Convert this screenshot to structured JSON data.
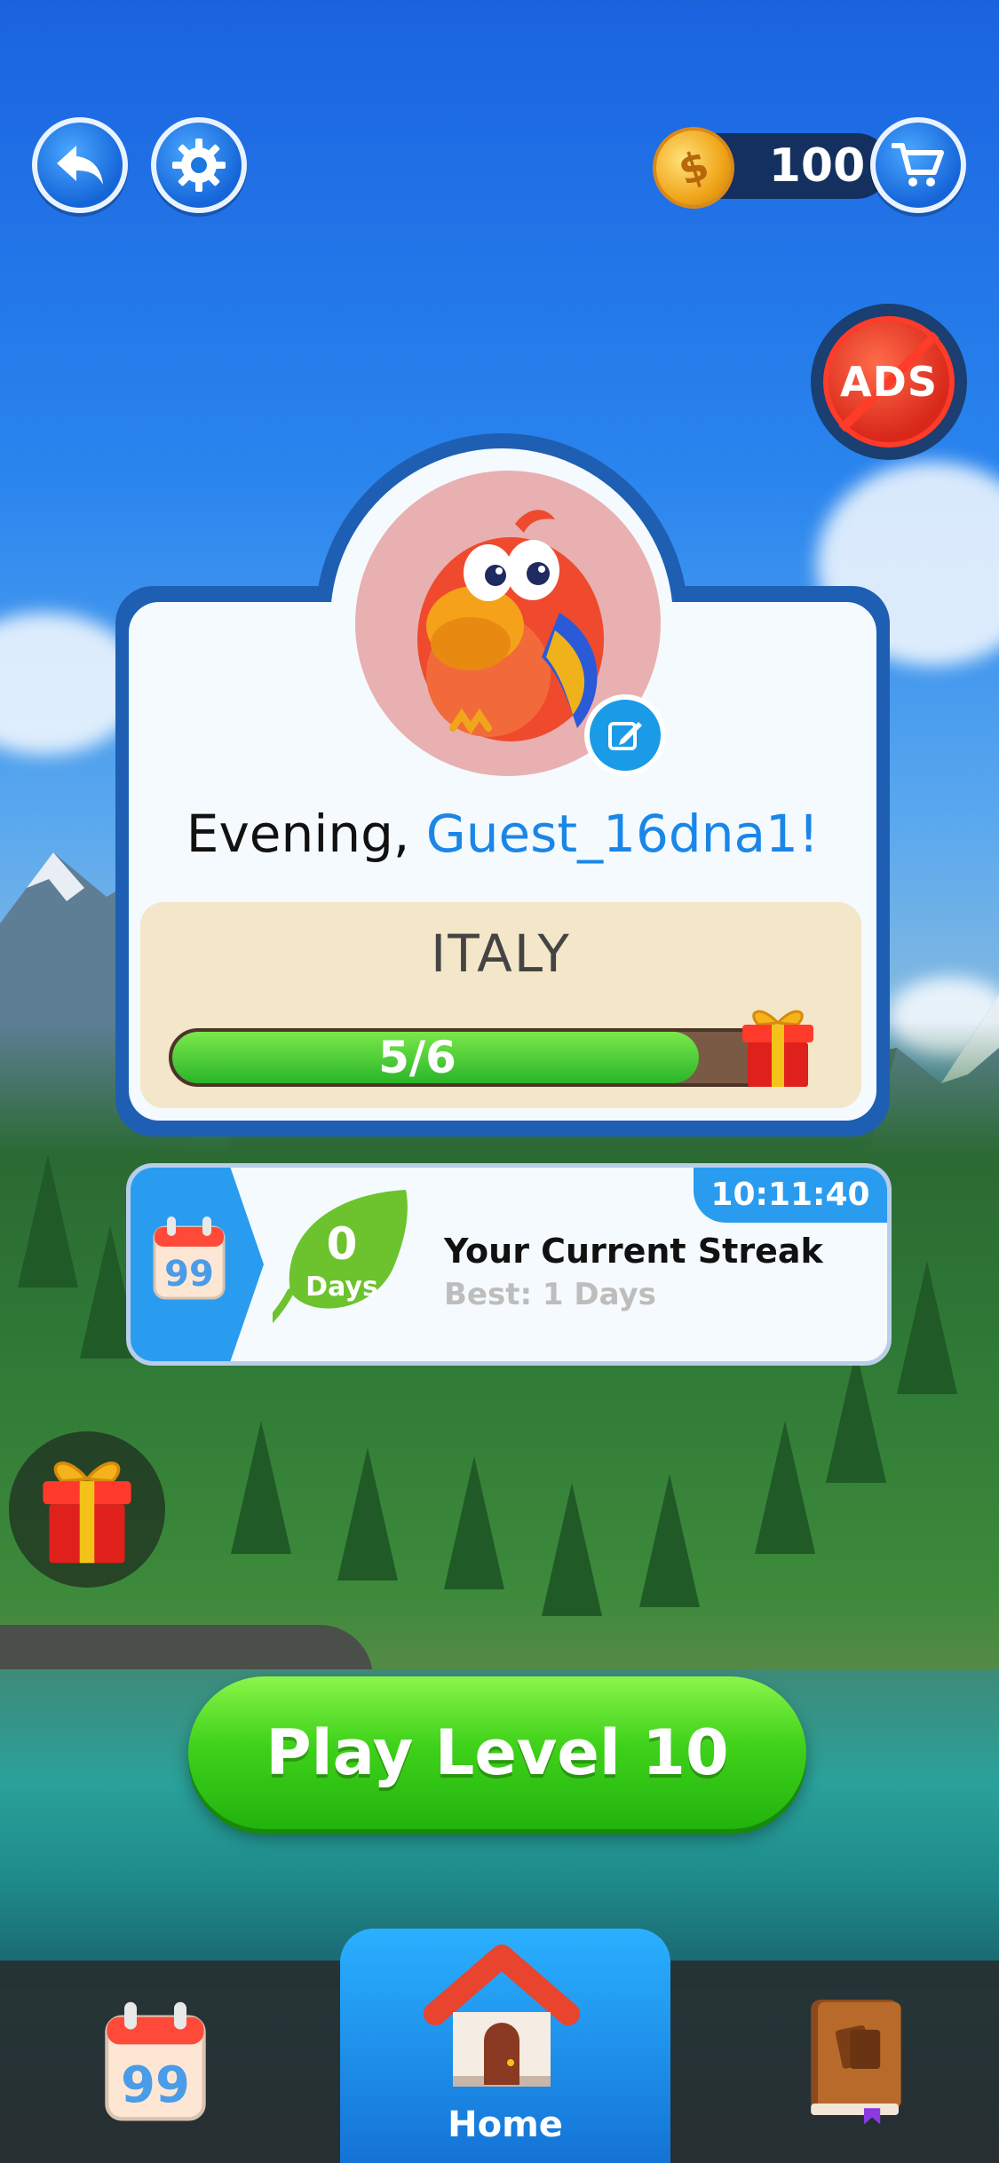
{
  "header": {
    "back_icon": "back-arrow-icon",
    "settings_icon": "gear-icon",
    "coins": "100",
    "coin_icon": "coin-icon",
    "shop_icon": "cart-icon"
  },
  "ads_button": {
    "label": "ADS"
  },
  "profile": {
    "greeting_prefix": "Evening,",
    "username": "Guest_16dna1!",
    "avatar_icon": "parrot-avatar",
    "edit_icon": "edit-icon"
  },
  "progress": {
    "country": "ITALY",
    "text": "5/6",
    "current": 5,
    "total": 6,
    "reward_icon": "gift-icon"
  },
  "streak": {
    "timer": "10:11:40",
    "count": "0",
    "days_label": "Days",
    "title": "Your Current Streak",
    "best": "Best: 1 Days",
    "calendar_icon": "calendar-quote-icon"
  },
  "play_button": {
    "label": "Play Level 10"
  },
  "bottom_nav": {
    "home_label": "Home",
    "left_icon": "daily-calendar-icon",
    "right_icon": "collection-book-icon"
  },
  "colors": {
    "accent_blue": "#1a86e8",
    "play_green": "#3fd21a",
    "progress_green": "#2bb52a"
  }
}
